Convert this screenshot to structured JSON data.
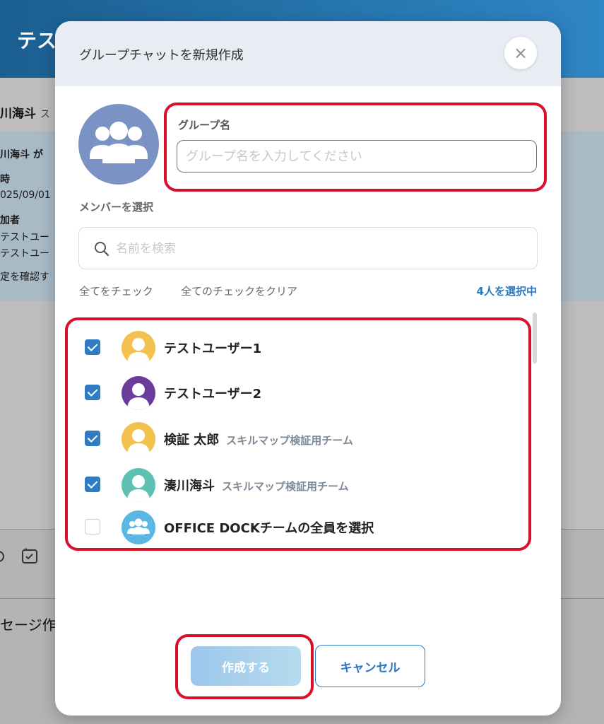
{
  "background": {
    "header_title": "テス",
    "user_name": "川海斗",
    "user_sub": "ス",
    "lines": [
      "川海斗 が",
      "時",
      "025/09/01",
      "加者",
      "テストユー",
      "テストユー",
      "定を確認す"
    ],
    "compose_label": "セージ作"
  },
  "modal": {
    "title": "グループチャットを新規作成",
    "close_symbol": "×",
    "group_name_label": "グループ名",
    "group_name_placeholder": "グループ名を入力してください",
    "group_name_value": "",
    "member_label": "メンバーを選択",
    "search_placeholder": "名前を検索",
    "check_all_label": "全てをチェック",
    "clear_all_label": "全てのチェックをクリア",
    "selected_count": "4人を選択中",
    "members": [
      {
        "name": "テストユーザー1",
        "team": "",
        "checked": true,
        "avatar_color": "#f2c14e",
        "avatar_type": "person-icon"
      },
      {
        "name": "テストユーザー2",
        "team": "",
        "checked": true,
        "avatar_color": "#6a3d9a",
        "avatar_type": "person-icon"
      },
      {
        "name": "検証 太郎",
        "team": "スキルマップ検証用チーム",
        "checked": true,
        "avatar_color": "#f2c14e",
        "avatar_type": "person-icon"
      },
      {
        "name": "湊川海斗",
        "team": "スキルマップ検証用チーム",
        "checked": true,
        "avatar_color": "#5fc0b4",
        "avatar_type": "person-icon"
      },
      {
        "name": "OFFICE DOCKチームの全員を選択",
        "team": "",
        "checked": false,
        "avatar_color": "#5ab7e4",
        "avatar_type": "group-icon"
      }
    ],
    "create_label": "作成する",
    "cancel_label": "キャンセル"
  },
  "colors": {
    "accent": "#2b78c4",
    "highlight": "#d8102a",
    "header_bg": "#e8edf3"
  }
}
